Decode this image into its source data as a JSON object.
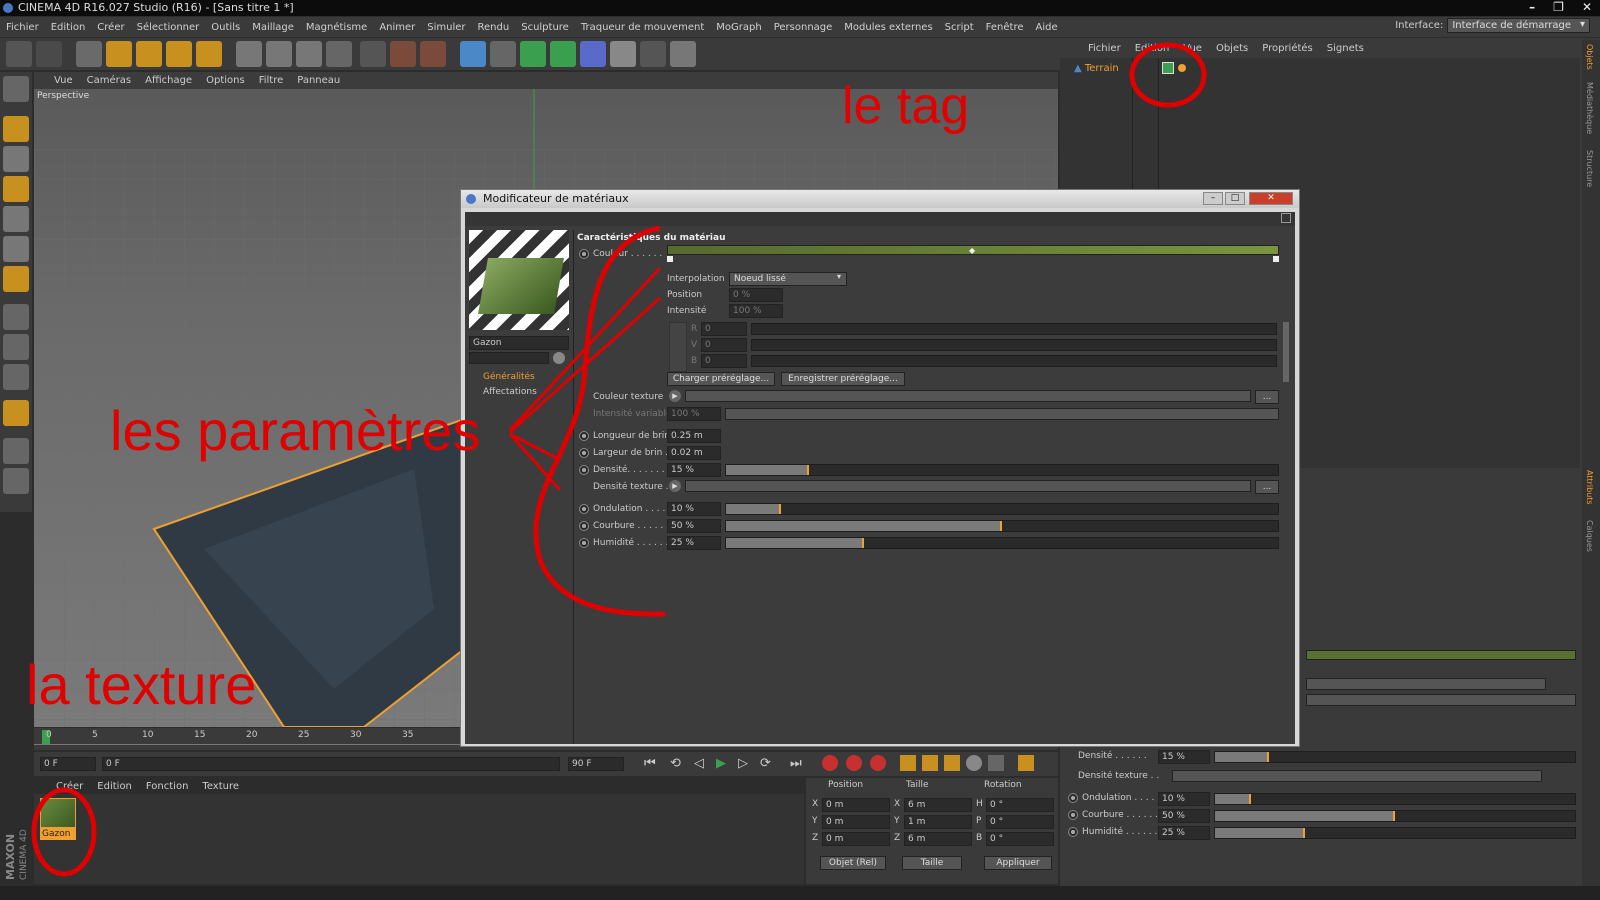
{
  "window": {
    "title": "CINEMA 4D R16.027 Studio (R16) - [Sans titre 1 *]"
  },
  "menubar": [
    "Fichier",
    "Edition",
    "Créer",
    "Sélectionner",
    "Outils",
    "Maillage",
    "Magnétisme",
    "Animer",
    "Simuler",
    "Rendu",
    "Sculpture",
    "Traqueur de mouvement",
    "MoGraph",
    "Personnage",
    "Modules externes",
    "Script",
    "Fenêtre",
    "Aide"
  ],
  "interface": {
    "label": "Interface:",
    "value": "Interface de démarrage"
  },
  "viewport": {
    "menu": [
      "Vue",
      "Caméras",
      "Affichage",
      "Options",
      "Filtre",
      "Panneau"
    ],
    "label": "Perspective"
  },
  "object_manager": {
    "menu": [
      "Fichier",
      "Edition",
      "Vue",
      "Objets",
      "Propriétés",
      "Signets"
    ],
    "object": "Terrain"
  },
  "side_tabs": [
    "Objets",
    "Médiathèque",
    "Structure",
    "Attributs",
    "Calques"
  ],
  "timeline": {
    "ticks": [
      "0",
      "5",
      "10",
      "15",
      "20",
      "25",
      "30",
      "35"
    ],
    "frame_start": "0 F",
    "frame_field": "0 F",
    "frame_end": "90 F",
    "frame_end2": "90 F"
  },
  "material_manager": {
    "menu": [
      "Créer",
      "Edition",
      "Fonction",
      "Texture"
    ],
    "material": "Gazon"
  },
  "coords": {
    "headers": [
      "Position",
      "Taille",
      "Rotation"
    ],
    "rows": [
      {
        "axis": "X",
        "pos": "0 m",
        "saxis": "X",
        "size": "6 m",
        "raxis": "H",
        "rot": "0 °"
      },
      {
        "axis": "Y",
        "pos": "0 m",
        "saxis": "Y",
        "size": "1 m",
        "raxis": "P",
        "rot": "0 °"
      },
      {
        "axis": "Z",
        "pos": "0 m",
        "saxis": "Z",
        "size": "6 m",
        "raxis": "B",
        "rot": "0 °"
      }
    ],
    "mode1": "Objet (Rel)",
    "mode2": "Taille",
    "apply": "Appliquer"
  },
  "attr_bottom": {
    "densite": "Densité . . . . . .",
    "densite_val": "15 %",
    "densite_fill": 0.15,
    "densite_tex": "Densité texture . .",
    "ondulation": "Ondulation . . . . .",
    "ondulation_val": "10 %",
    "ondulation_fill": 0.1,
    "courbure": "Courbure . . . . . .",
    "courbure_val": "50 %",
    "courbure_fill": 0.5,
    "humidite": "Humidité . . . . . .",
    "humidite_val": "25 %",
    "humidite_fill": 0.25
  },
  "dialog": {
    "title": "Modificateur de matériaux",
    "material_name": "Gazon",
    "tabs": [
      "Généralités",
      "Affectations"
    ],
    "section": "Caractéristiques du matériau",
    "couleur": "Couleur . . . . . .",
    "interp_label": "Interpolation",
    "interp_value": "Noeud lissé",
    "position_label": "Position",
    "position_value": "0 %",
    "intensite_label": "Intensité",
    "intensite_value": "100 %",
    "r_label": "R",
    "r_value": "0",
    "v_label": "V",
    "v_value": "0",
    "b_label": "B",
    "b_value": "0",
    "load_preset": "Charger préréglage...",
    "save_preset": "Enregistrer préréglage...",
    "couleur_texture": "Couleur texture",
    "intensite_var": "Intensité variable",
    "intensite_var_val": "100 %",
    "longueur": "Longueur de brin",
    "longueur_val": "0.25 m",
    "largeur": "Largeur de brin . .",
    "largeur_val": "0.02 m",
    "densite": "Densité. . . . . . . .",
    "densite_val": "15 %",
    "densite_fill": 0.15,
    "densite_tex": "Densité texture . .",
    "ondulation": "Ondulation . . . . .",
    "ondulation_val": "10 %",
    "ondulation_fill": 0.1,
    "courbure": "Courbure . . . . . .",
    "courbure_val": "50 %",
    "courbure_fill": 0.5,
    "humidite": "Humidité . . . . . .",
    "humidite_val": "25 %",
    "humidite_fill": 0.25
  },
  "annotations": {
    "tag": "le tag",
    "params": "les paramètres",
    "texture": "la texture"
  },
  "logo": {
    "maxon": "MAXON",
    "c4d": "CINEMA 4D"
  },
  "colors": {
    "accent": "#f0a030",
    "annotation": "#e00000",
    "gradient": "#6f8a3c"
  }
}
